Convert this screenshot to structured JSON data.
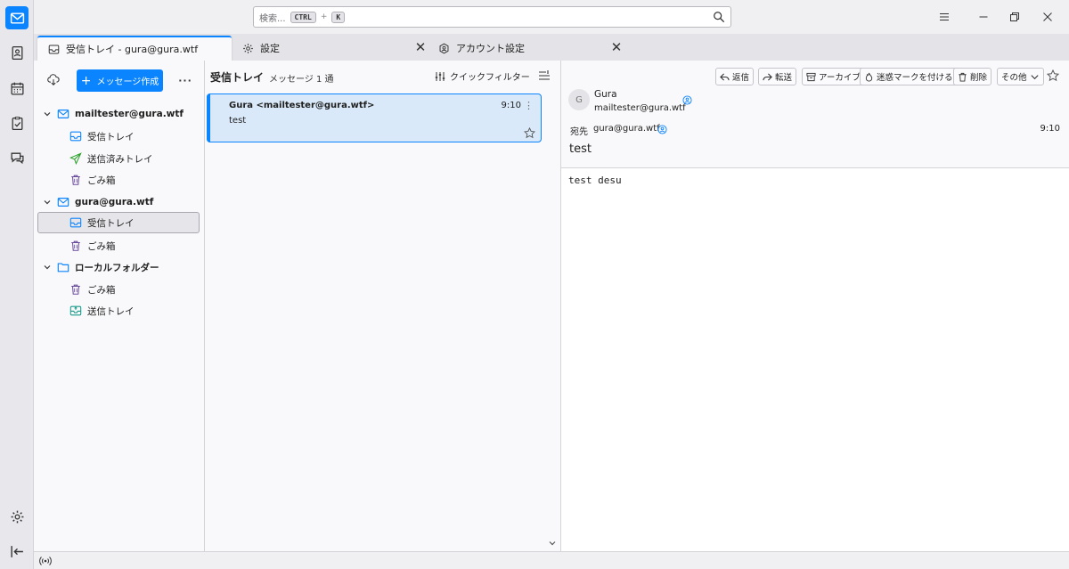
{
  "titlebar": {
    "search_placeholder": "検索...",
    "shortcut_key1": "CTRL",
    "shortcut_plus": "+",
    "shortcut_key2": "K"
  },
  "tabs": [
    {
      "label": "受信トレイ - gura@gura.wtf",
      "icon": "inbox-icon",
      "active": true
    },
    {
      "label": "設定",
      "icon": "gear-icon"
    },
    {
      "label": "アカウント設定",
      "icon": "account-settings-icon"
    }
  ],
  "tab_close": "✕",
  "folder_pane": {
    "compose_plus": "+",
    "compose_label": "メッセージ作成",
    "more": "···",
    "items": [
      {
        "label": "mailtester@gura.wtf",
        "type": "account"
      },
      {
        "label": "受信トレイ",
        "type": "inbox"
      },
      {
        "label": "送信済みトレイ",
        "type": "sent"
      },
      {
        "label": "ごみ箱",
        "type": "trash"
      },
      {
        "label": "gura@gura.wtf",
        "type": "account"
      },
      {
        "label": "受信トレイ",
        "type": "inbox",
        "selected": true
      },
      {
        "label": "ごみ箱",
        "type": "trash"
      },
      {
        "label": "ローカルフォルダー",
        "type": "local"
      },
      {
        "label": "ごみ箱",
        "type": "trash"
      },
      {
        "label": "送信トレイ",
        "type": "outbox"
      }
    ]
  },
  "thread_pane": {
    "folder_title": "受信トレイ",
    "message_count": "メッセージ 1 通",
    "quick_filter": "クイックフィルター",
    "messages": [
      {
        "sender": "Gura <mailtester@gura.wtf>",
        "time": "9:10",
        "subject": "test"
      }
    ]
  },
  "message_header": {
    "buttons": {
      "reply": "返信",
      "forward": "転送",
      "archive": "アーカイブ",
      "junk": "迷惑マークを付ける",
      "delete": "削除",
      "other": "その他"
    },
    "avatar_initial": "G",
    "from_name": "Gura",
    "from_address": "mailtester@gura.wtf",
    "to_label": "宛先",
    "to_address": "gura@gura.wtf",
    "time": "9:10",
    "subject": "test"
  },
  "message_body": "test desu",
  "colors": {
    "accent": "#0a84ff",
    "selected_row": "#d9e9f9"
  }
}
